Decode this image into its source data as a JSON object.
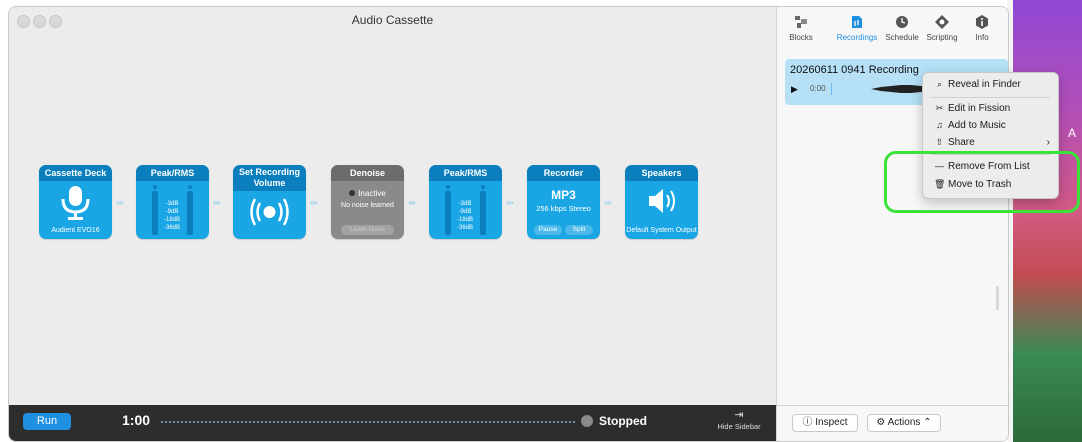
{
  "window": {
    "title": "Audio Cassette"
  },
  "blocks": [
    {
      "title": "Cassette Deck",
      "subtitle": "Audient EVO16"
    },
    {
      "title": "Peak/RMS",
      "levels": [
        "-3dB",
        "-9dB",
        "-18dB",
        "-36dB"
      ]
    },
    {
      "title": "Set Recording Volume"
    },
    {
      "title": "Denoise",
      "status": "Inactive",
      "detail": "No noise learned",
      "button": "Learn Noise"
    },
    {
      "title": "Peak/RMS",
      "levels": [
        "-3dB",
        "-9dB",
        "-18dB",
        "-36dB"
      ]
    },
    {
      "title": "Recorder",
      "format": "MP3",
      "detail": "256 kbps Stereo",
      "buttons": [
        "Pause",
        "Split"
      ]
    },
    {
      "title": "Speakers",
      "subtitle": "Default System Output"
    }
  ],
  "bottombar": {
    "run_label": "Run",
    "time": "1:00",
    "status": "Stopped",
    "hide_sidebar": "Hide Sidebar"
  },
  "sidebar": {
    "tabs": [
      {
        "label": "Blocks",
        "icon": "blocks-icon"
      },
      {
        "label": "Recordings",
        "icon": "recordings-icon",
        "active": true
      },
      {
        "label": "Schedule",
        "icon": "clock-icon"
      },
      {
        "label": "Scripting",
        "icon": "scripting-icon"
      },
      {
        "label": "Info",
        "icon": "info-icon"
      }
    ],
    "recording": {
      "title": "20260611 0941 Recording",
      "time": "0:00"
    },
    "inspect_label": "Inspect",
    "actions_label": "Actions"
  },
  "context_menu": {
    "items": [
      {
        "label": "Reveal in Finder",
        "icon": "search-icon"
      },
      {
        "label": "Edit in Fission",
        "icon": "scissors-icon"
      },
      {
        "label": "Add to Music",
        "icon": "music-icon"
      },
      {
        "label": "Share",
        "icon": "share-icon",
        "submenu": true
      },
      {
        "label": "Remove From List",
        "icon": "minus-icon"
      },
      {
        "label": "Move to Trash",
        "icon": "trash-icon"
      }
    ]
  },
  "colors": {
    "accent": "#1aa6e4",
    "block_header": "#0b7fbd",
    "highlight": "#39e33a"
  }
}
